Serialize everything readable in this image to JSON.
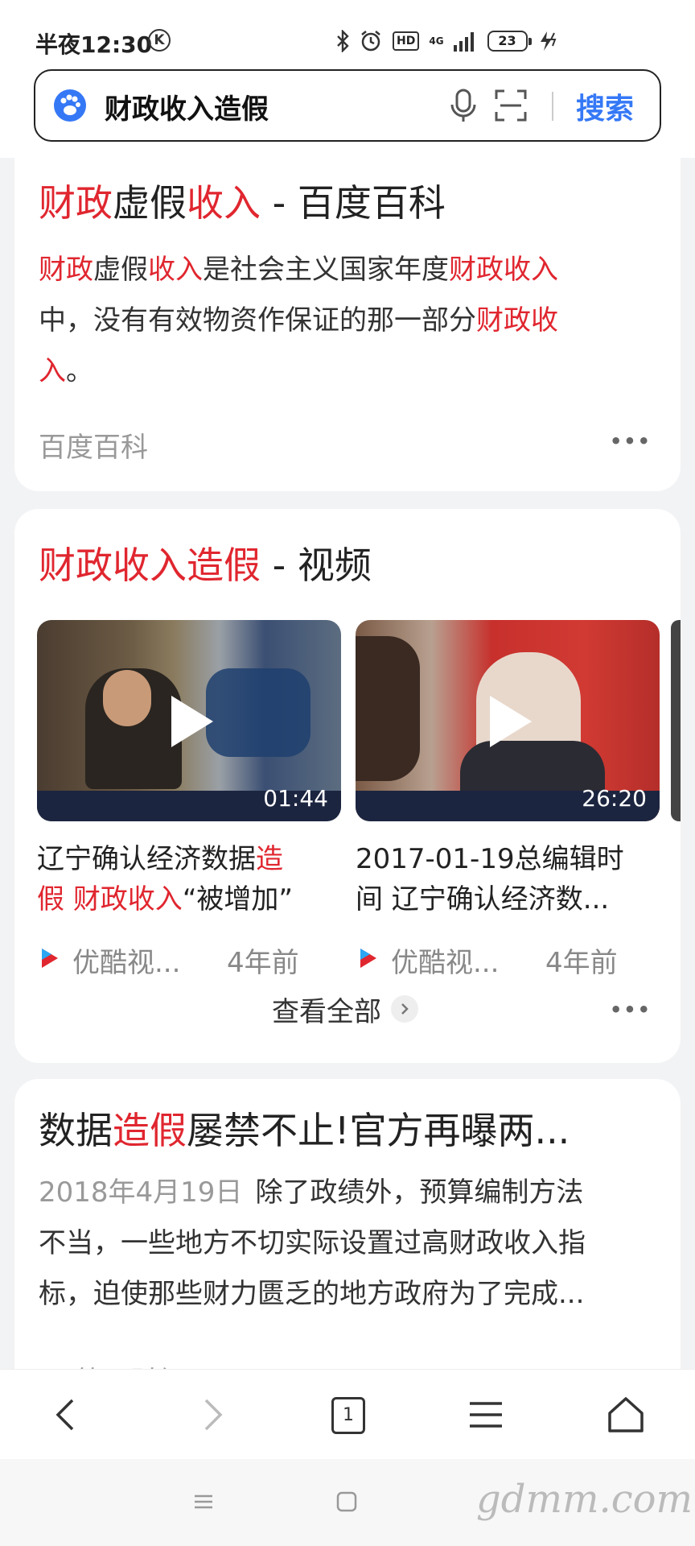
{
  "status_bar": {
    "time": "半夜12:30",
    "k_badge": "K",
    "hd": "HD",
    "network": "4G",
    "battery": "23"
  },
  "search": {
    "query": "财政收入造假",
    "button": "搜索",
    "icons": [
      "paw-logo-icon",
      "microphone-icon",
      "scan-icon"
    ]
  },
  "result1": {
    "title_parts": [
      "财政",
      "虚假",
      "收入",
      " - 百度百科"
    ],
    "text_lines": [
      [
        "财政",
        "虚假",
        "收入",
        "是社会主义国家年度",
        "财政收入"
      ],
      [
        "中，没有有效物资作保证的那一部分",
        "财政收"
      ],
      [
        "入",
        "。"
      ]
    ],
    "source": "百度百科",
    "more": "•••"
  },
  "video_card": {
    "title_parts": [
      "财政收入造假",
      " - 视频"
    ],
    "videos": [
      {
        "title_line1": [
          "辽宁确认经济数据",
          "造"
        ],
        "title_line2": [
          "假",
          " ",
          "财政收入",
          "“被增加”"
        ],
        "duration": "01:44",
        "source": "优酷视...",
        "time": "4年前"
      },
      {
        "title_line1": [
          "2017-01-19总编辑时"
        ],
        "title_line2": [
          "间 辽宁确认经济数..."
        ],
        "duration": "26:20",
        "source": "优酷视...",
        "time": "4年前"
      }
    ],
    "view_all": "查看全部",
    "more": "•••"
  },
  "result3": {
    "title_parts": [
      "数据",
      "造假",
      "屡禁不止!官方再曝两..."
    ],
    "date": "2018年4月19日",
    "text_lines": [
      "除了政绩外，预算编制方法",
      "不当，一些地方不切实际设置过高财政收入指",
      "标，迫使那些财力匮乏的地方政府为了完成..."
    ],
    "source_partial": "第一财经"
  },
  "bottom_nav": {
    "tab_count": "1"
  },
  "watermark": "gdmm.com",
  "colors": {
    "highlight": "#e0262f",
    "accent": "#3578f6",
    "background": "#f2f3f5"
  }
}
